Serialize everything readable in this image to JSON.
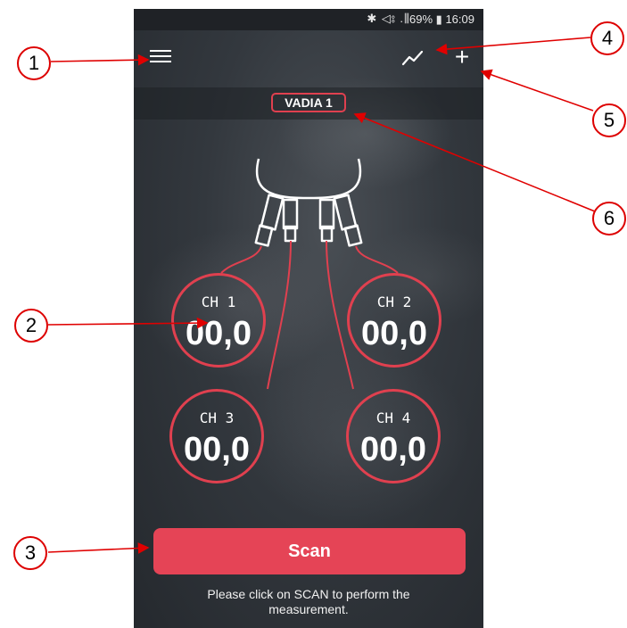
{
  "status_bar": {
    "icons": "✱ ◁⦂ .⫼",
    "battery": "69%",
    "time": "16:09"
  },
  "toolbar": {
    "menu_icon": "menu-icon",
    "chart_icon": "trend-chart-icon",
    "add_icon_glyph": "+"
  },
  "device": {
    "name": "VADIA 1"
  },
  "channels": [
    {
      "label": "CH 1",
      "value": "00,0"
    },
    {
      "label": "CH 2",
      "value": "00,0"
    },
    {
      "label": "CH 3",
      "value": "00,0"
    },
    {
      "label": "CH 4",
      "value": "00,0"
    }
  ],
  "scan": {
    "label": "Scan",
    "hint": "Please click on SCAN to perform the measurement."
  },
  "callouts": [
    "1",
    "2",
    "3",
    "4",
    "5",
    "6"
  ],
  "colors": {
    "accent": "#e54456",
    "ring": "#e0404f",
    "background": "#2f3338",
    "callout_border": "#dd0000"
  }
}
